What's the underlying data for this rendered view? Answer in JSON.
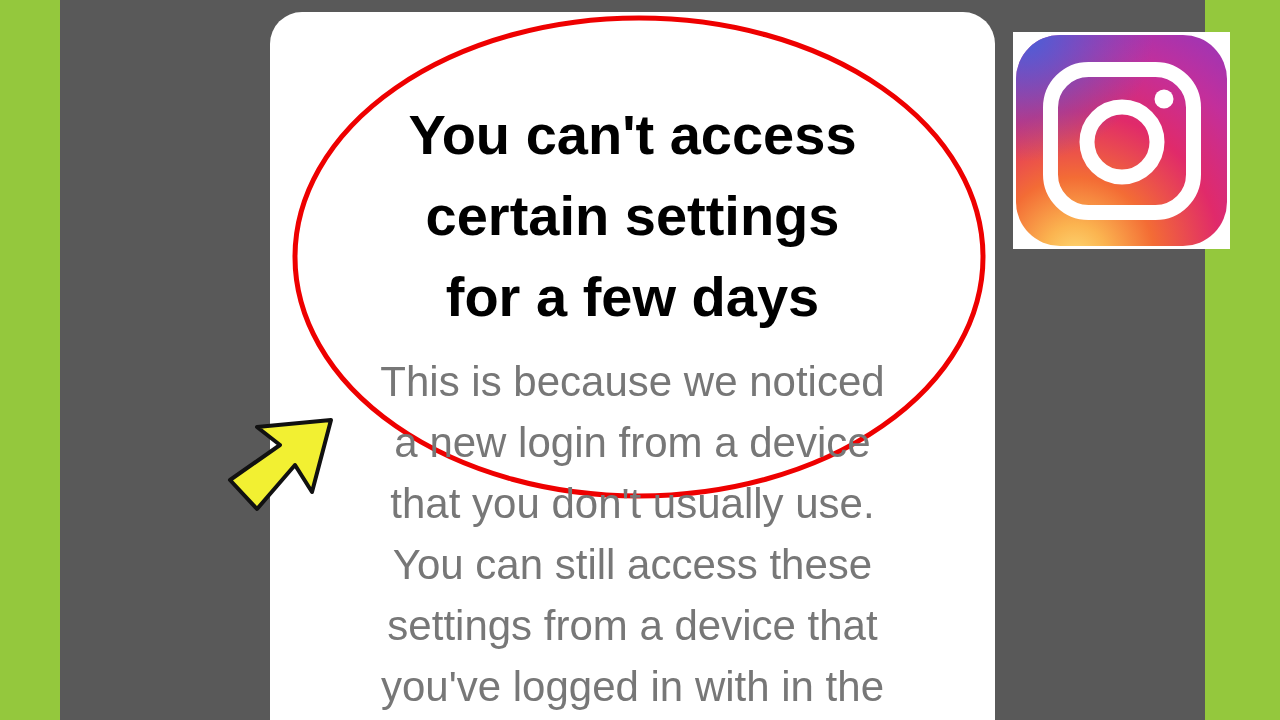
{
  "dialog": {
    "title": "You can't access certain settings for a few days",
    "body": "This is because we noticed a new login from a device that you don't usually use. You can still access these settings from a device that you've logged in with in the"
  }
}
